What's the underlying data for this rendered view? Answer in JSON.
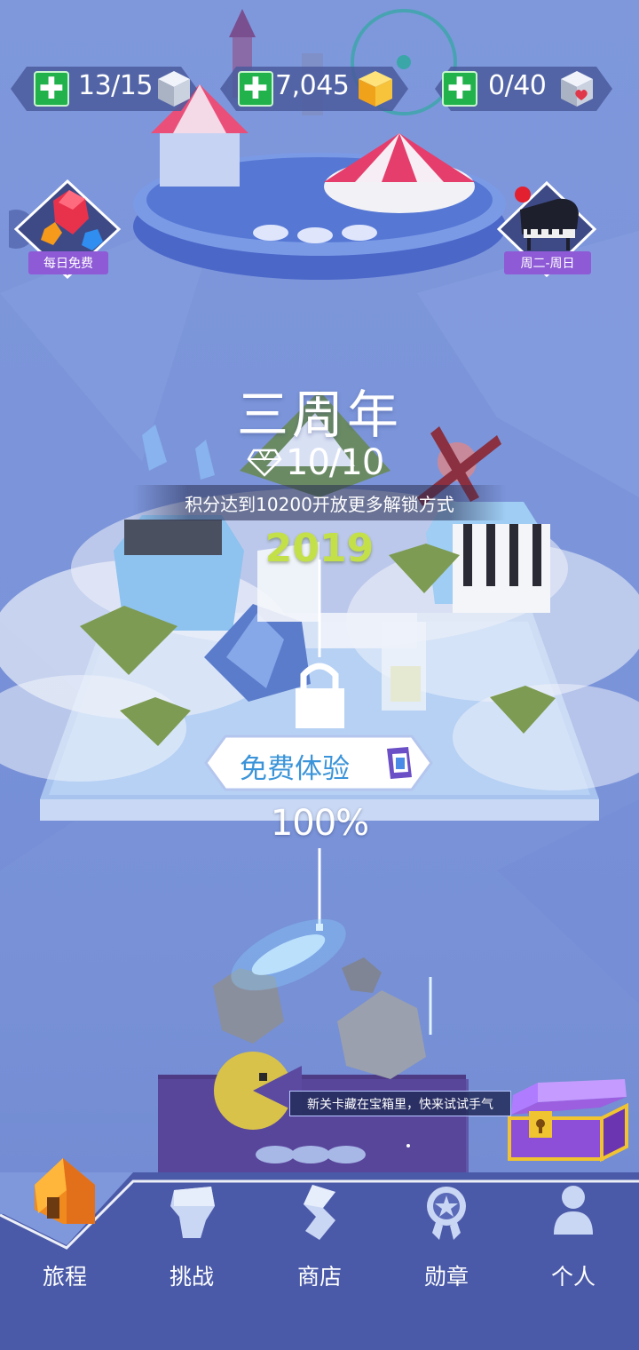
{
  "resources": [
    {
      "id": "energy",
      "value": "13/15",
      "icon": "gray-cube-icon"
    },
    {
      "id": "coins",
      "value": "7,045",
      "icon": "gold-cube-icon"
    },
    {
      "id": "hearts",
      "value": "0/40",
      "icon": "heart-cube-icon"
    }
  ],
  "left_event": {
    "label": "每日免费",
    "icon": "gem-balloon-icon"
  },
  "right_event": {
    "label": "周二-周日",
    "icon": "piano-icon",
    "has_notification": true
  },
  "level": {
    "title": "三周年",
    "score": "10/10",
    "unlock_hint": "积分达到10200开放更多解锁方式",
    "year": "2019",
    "free_trial_label": "免费体验",
    "progress": "100%"
  },
  "chest_tip": "新关卡藏在宝箱里，快来试试手气",
  "nav": {
    "items": [
      {
        "label": "旅程",
        "icon": "home-icon",
        "active": true
      },
      {
        "label": "挑战",
        "icon": "challenge-icon",
        "active": false
      },
      {
        "label": "商店",
        "icon": "shop-icon",
        "active": false
      },
      {
        "label": "勋章",
        "icon": "medal-icon",
        "active": false
      },
      {
        "label": "个人",
        "icon": "person-icon",
        "active": false
      }
    ]
  },
  "colors": {
    "accent_green": "#22b24c",
    "year_green": "#c4e048",
    "free_blue": "#3b94d9",
    "label_purple": "#8e5ad6",
    "nav_bg": "#4a5aa8"
  }
}
